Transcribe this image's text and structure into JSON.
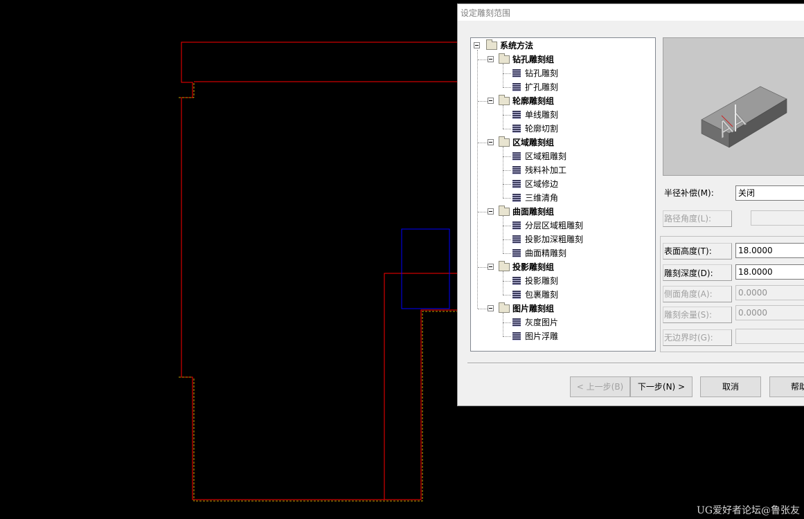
{
  "dialog": {
    "title": "设定雕刻范围",
    "tree": {
      "root": "系统方法",
      "groups": [
        {
          "label": "钻孔雕刻组",
          "items": [
            "钻孔雕刻",
            "扩孔雕刻"
          ]
        },
        {
          "label": "轮廓雕刻组",
          "items": [
            "单线雕刻",
            "轮廓切割"
          ]
        },
        {
          "label": "区域雕刻组",
          "items": [
            "区域粗雕刻",
            "残料补加工",
            "区域修边",
            "三维清角"
          ]
        },
        {
          "label": "曲面雕刻组",
          "items": [
            "分层区域粗雕刻",
            "投影加深粗雕刻",
            "曲面精雕刻"
          ]
        },
        {
          "label": "投影雕刻组",
          "items": [
            "投影雕刻",
            "包裹雕刻"
          ]
        },
        {
          "label": "图片雕刻组",
          "items": [
            "灰度图片",
            "图片浮雕"
          ]
        }
      ]
    },
    "preview": {
      "text": "AA"
    },
    "fields": {
      "radius_comp": {
        "label": "半径补偿(M):",
        "value": "关闭"
      },
      "path_angle": {
        "label": "路径角度(L):",
        "value": ""
      },
      "surface_height": {
        "label": "表面高度(T):",
        "value": "18.0000"
      },
      "engrave_depth": {
        "label": "雕刻深度(D):",
        "value": "18.0000"
      },
      "side_angle": {
        "label": "侧面角度(A):",
        "value": "0.0000"
      },
      "engrave_allowance": {
        "label": "雕刻余量(S):",
        "value": "0.0000"
      },
      "no_boundary": {
        "label": "无边界时(G):",
        "value": ""
      }
    },
    "buttons": {
      "prev": "< 上一步(B)",
      "next": "下一步(N) >",
      "cancel": "取消",
      "help": "帮助"
    }
  },
  "watermark": "UG爱好者论坛@鲁张友",
  "colors": {
    "cad_outline": "#ff0000",
    "cad_selection": "#0000ff",
    "cad_dashed": "#c8a000",
    "background": "#000000"
  }
}
